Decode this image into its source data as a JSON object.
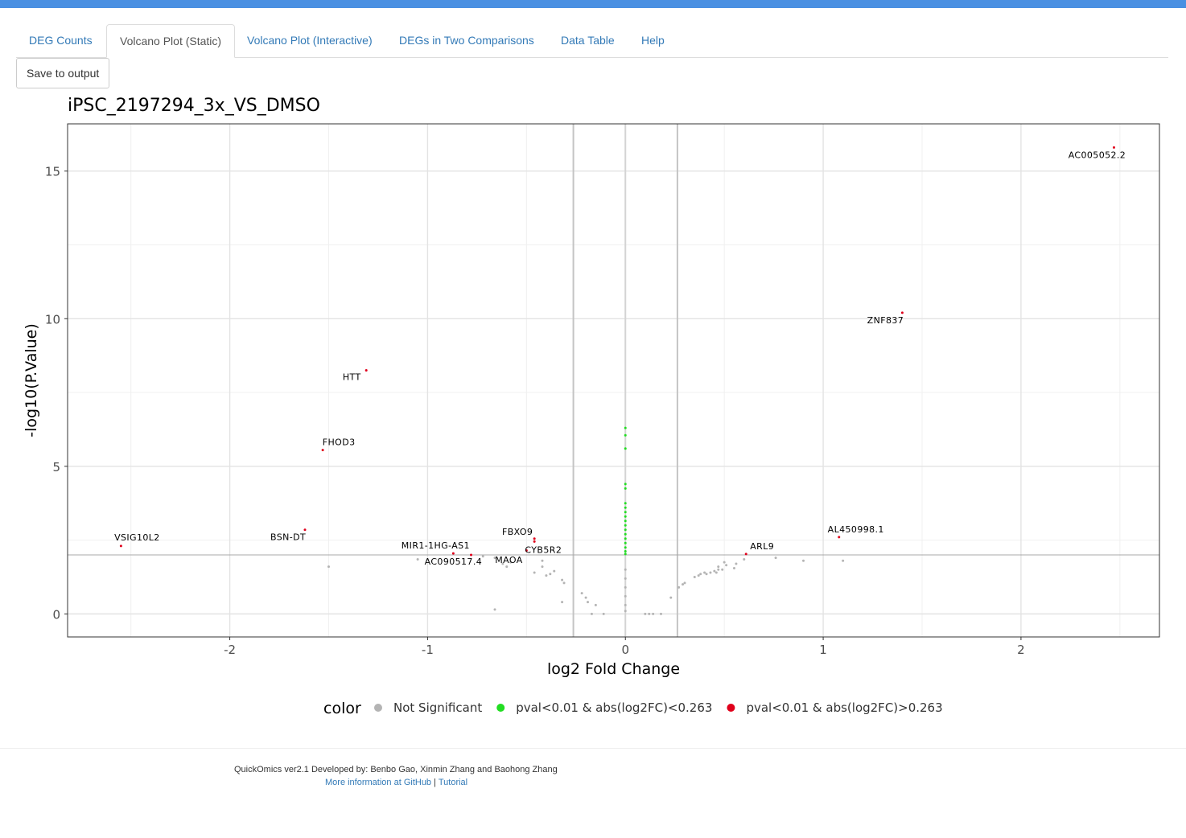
{
  "tabs": [
    {
      "label": "DEG Counts",
      "active": false
    },
    {
      "label": "Volcano Plot (Static)",
      "active": true
    },
    {
      "label": "Volcano Plot (Interactive)",
      "active": false
    },
    {
      "label": "DEGs in Two Comparisons",
      "active": false
    },
    {
      "label": "Data Table",
      "active": false
    },
    {
      "label": "Help",
      "active": false
    }
  ],
  "toolbar": {
    "save_label": "Save to output"
  },
  "chart_data": {
    "type": "scatter",
    "title": "iPSC_2197294_3x_VS_DMSO",
    "xlabel": "log2 Fold Change",
    "ylabel": "-log10(P.Value)",
    "xlim": [
      -2.82,
      2.7
    ],
    "ylim": [
      -0.78,
      16.6
    ],
    "xticks": [
      -2,
      -1,
      0,
      1,
      2
    ],
    "yticks": [
      0,
      5,
      10,
      15
    ],
    "vlines": [
      -0.263,
      0.263
    ],
    "hline": 2,
    "grid": true,
    "legend": {
      "title": "color",
      "position": "bottom",
      "entries": [
        {
          "name": "Not Significant",
          "color": "#b4b4b4"
        },
        {
          "name": "pval<0.01 & abs(log2FC)<0.263",
          "color": "#22dd22"
        },
        {
          "name": "pval<0.01 & abs(log2FC)>0.263",
          "color": "#e0001b"
        }
      ]
    },
    "series": [
      {
        "name": "Not Significant",
        "color": "#b4b4b4",
        "points": [
          [
            -1.5,
            1.6
          ],
          [
            -1.05,
            1.85
          ],
          [
            -0.72,
            1.95
          ],
          [
            -0.66,
            1.9
          ],
          [
            -0.62,
            1.7
          ],
          [
            -0.6,
            1.6
          ],
          [
            -0.58,
            1.75
          ],
          [
            -0.66,
            0.15
          ],
          [
            -0.46,
            1.4
          ],
          [
            -0.42,
            1.8
          ],
          [
            -0.42,
            1.6
          ],
          [
            -0.4,
            1.3
          ],
          [
            -0.38,
            1.35
          ],
          [
            -0.36,
            1.45
          ],
          [
            -0.32,
            1.15
          ],
          [
            -0.31,
            1.05
          ],
          [
            -0.32,
            0.4
          ],
          [
            -0.22,
            0.7
          ],
          [
            -0.2,
            0.55
          ],
          [
            -0.19,
            0.4
          ],
          [
            -0.17,
            0.0
          ],
          [
            -0.15,
            0.3
          ],
          [
            -0.11,
            0.0
          ],
          [
            0.0,
            1.5
          ],
          [
            0.0,
            1.2
          ],
          [
            0.0,
            0.9
          ],
          [
            0.0,
            0.6
          ],
          [
            0.0,
            0.3
          ],
          [
            0.0,
            0.1
          ],
          [
            0.1,
            0.0
          ],
          [
            0.12,
            0.0
          ],
          [
            0.14,
            0.0
          ],
          [
            0.18,
            0.0
          ],
          [
            0.23,
            0.55
          ],
          [
            0.27,
            0.9
          ],
          [
            0.29,
            1.0
          ],
          [
            0.3,
            1.05
          ],
          [
            0.35,
            1.25
          ],
          [
            0.37,
            1.3
          ],
          [
            0.38,
            1.35
          ],
          [
            0.4,
            1.4
          ],
          [
            0.41,
            1.35
          ],
          [
            0.43,
            1.4
          ],
          [
            0.45,
            1.45
          ],
          [
            0.46,
            1.4
          ],
          [
            0.47,
            1.5
          ],
          [
            0.47,
            1.6
          ],
          [
            0.49,
            1.5
          ],
          [
            0.5,
            1.75
          ],
          [
            0.51,
            1.65
          ],
          [
            0.55,
            1.55
          ],
          [
            0.56,
            1.7
          ],
          [
            0.6,
            1.85
          ],
          [
            0.76,
            1.9
          ],
          [
            0.9,
            1.8
          ],
          [
            1.1,
            1.8
          ]
        ]
      },
      {
        "name": "pval<0.01 & abs(log2FC)<0.263",
        "color": "#22dd22",
        "points": [
          [
            0.0,
            6.3
          ],
          [
            0.0,
            6.05
          ],
          [
            0.0,
            5.6
          ],
          [
            0.0,
            4.4
          ],
          [
            0.0,
            4.25
          ],
          [
            0.0,
            3.75
          ],
          [
            0.0,
            3.6
          ],
          [
            0.0,
            3.45
          ],
          [
            0.0,
            3.3
          ],
          [
            0.0,
            3.15
          ],
          [
            0.0,
            3.0
          ],
          [
            0.0,
            2.85
          ],
          [
            0.0,
            2.7
          ],
          [
            0.0,
            2.55
          ],
          [
            0.0,
            2.4
          ],
          [
            0.0,
            2.25
          ],
          [
            0.0,
            2.12
          ],
          [
            0.0,
            2.03
          ]
        ]
      },
      {
        "name": "pval<0.01 & abs(log2FC)>0.263",
        "color": "#e0001b",
        "points": [
          [
            2.47,
            15.8
          ],
          [
            1.4,
            10.2
          ],
          [
            -1.31,
            8.25
          ],
          [
            -1.53,
            5.55
          ],
          [
            -2.55,
            2.3
          ],
          [
            -1.62,
            2.85
          ],
          [
            -0.46,
            2.55
          ],
          [
            -0.46,
            2.45
          ],
          [
            -0.5,
            2.15
          ],
          [
            -0.87,
            2.05
          ],
          [
            -0.78,
            2.0
          ],
          [
            1.08,
            2.6
          ],
          [
            0.61,
            2.03
          ]
        ]
      }
    ],
    "labels": [
      {
        "text": "AC005052.2",
        "x": 2.47,
        "y": 15.8
      },
      {
        "text": "ZNF837",
        "x": 1.4,
        "y": 10.2
      },
      {
        "text": "HTT",
        "x": -1.31,
        "y": 8.25
      },
      {
        "text": "FHOD3",
        "x": -1.53,
        "y": 5.55
      },
      {
        "text": "VSIG10L2",
        "x": -2.55,
        "y": 2.3
      },
      {
        "text": "BSN-DT",
        "x": -1.62,
        "y": 2.85
      },
      {
        "text": "FBXO9",
        "x": -0.46,
        "y": 2.55
      },
      {
        "text": "CYB5R2",
        "x": -0.5,
        "y": 2.15
      },
      {
        "text": "MIR1-1HG-AS1",
        "x": -0.87,
        "y": 2.05
      },
      {
        "text": "AC090517.4",
        "x": -0.87,
        "y": 2.05
      },
      {
        "text": "MAOA",
        "x": -0.78,
        "y": 2.0
      },
      {
        "text": "AL450998.1",
        "x": 1.08,
        "y": 2.6
      },
      {
        "text": "ARL9",
        "x": 0.61,
        "y": 2.03
      }
    ]
  },
  "footer": {
    "credit": "QuickOmics ver2.1 Developed by: Benbo Gao, Xinmin Zhang and Baohong Zhang",
    "github_link": "More information at GitHub",
    "separator": " | ",
    "tutorial_link": "Tutorial"
  }
}
